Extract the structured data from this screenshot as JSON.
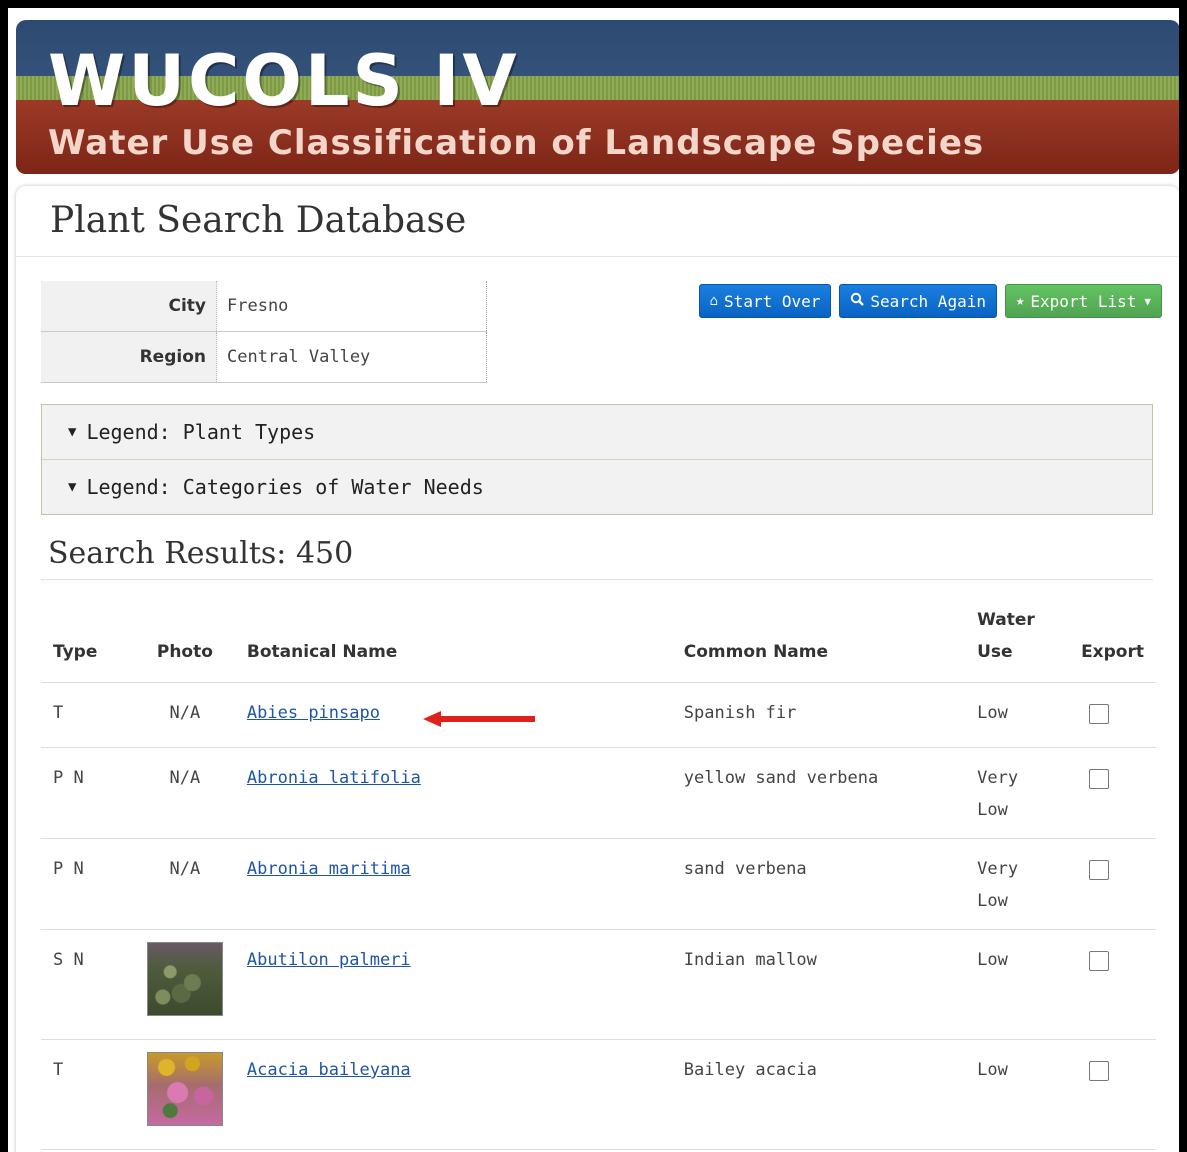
{
  "banner": {
    "title": "WUCOLS IV",
    "subtitle": "Water Use Classification of Landscape Species"
  },
  "page_title": "Plant Search Database",
  "location": {
    "city_label": "City",
    "city_value": "Fresno",
    "region_label": "Region",
    "region_value": "Central Valley"
  },
  "buttons": {
    "start_over": "Start Over",
    "search_again": "Search Again",
    "export_list": "Export List"
  },
  "legends": {
    "plant_types": "Legend: Plant Types",
    "water_needs": "Legend: Categories of Water Needs"
  },
  "results": {
    "title": "Search Results: 450",
    "headers": {
      "type": "Type",
      "photo": "Photo",
      "botanical": "Botanical Name",
      "common": "Common Name",
      "water_use_1": "Water",
      "water_use_2": "Use",
      "export": "Export"
    },
    "rows": [
      {
        "type": "T",
        "photo": "N/A",
        "botanical": "Abies pinsapo",
        "common": "Spanish fir",
        "water_use": "Low"
      },
      {
        "type": "P N",
        "photo": "N/A",
        "botanical": "Abronia latifolia",
        "common": "yellow sand verbena",
        "water_use_1": "Very",
        "water_use_2": "Low"
      },
      {
        "type": "P N",
        "photo": "N/A",
        "botanical": "Abronia maritima",
        "common": "sand verbena",
        "water_use_1": "Very",
        "water_use_2": "Low"
      },
      {
        "type": "S N",
        "botanical": "Abutilon palmeri",
        "common": "Indian mallow",
        "water_use": "Low"
      },
      {
        "type": "T",
        "botanical": "Acacia baileyana",
        "common": "Bailey acacia",
        "water_use": "Low"
      }
    ]
  },
  "colors": {
    "banner_blue": "#34517a",
    "banner_red": "#8b2e1e",
    "button_blue": "#0a63c3",
    "button_green": "#51a351",
    "link": "#1e55a8",
    "arrow": "#e0201a"
  }
}
